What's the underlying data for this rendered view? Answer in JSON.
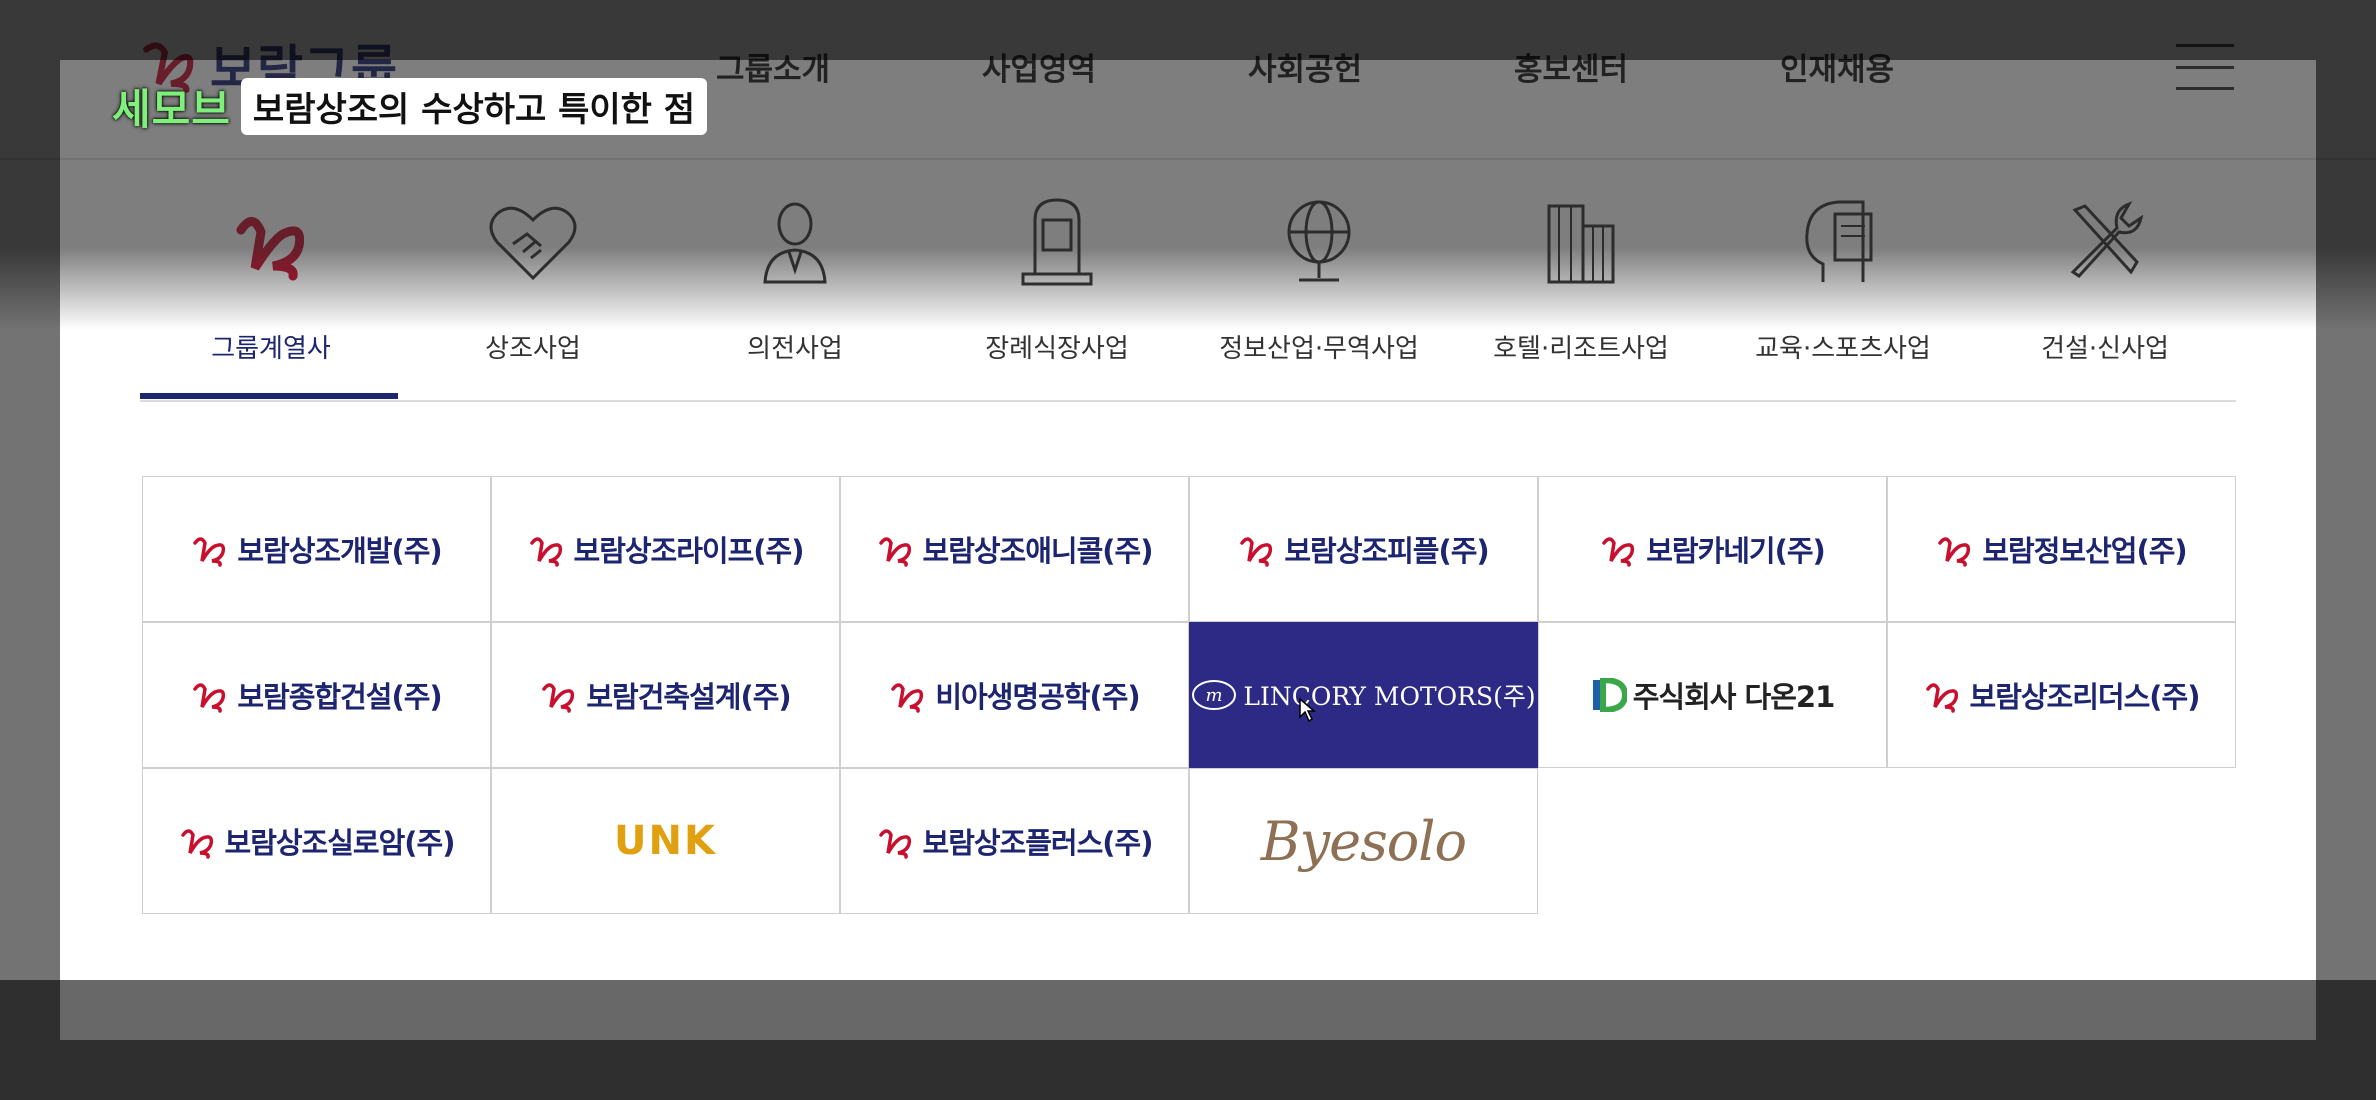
{
  "header": {
    "logo_text": "보람그룹",
    "nav": [
      "그룹소개",
      "사업영역",
      "사회공헌",
      "홍보센터",
      "인재채용"
    ]
  },
  "categories": [
    {
      "label": "그룹계열사",
      "icon": "boram-b-logo-icon",
      "active": true
    },
    {
      "label": "상조사업",
      "icon": "handshake-heart-icon"
    },
    {
      "label": "의전사업",
      "icon": "person-suit-icon"
    },
    {
      "label": "장례식장사업",
      "icon": "tombstone-icon"
    },
    {
      "label": "정보산업·무역사업",
      "icon": "globe-icon"
    },
    {
      "label": "호텔·리조트사업",
      "icon": "buildings-icon"
    },
    {
      "label": "교육·스포츠사업",
      "icon": "head-book-icon"
    },
    {
      "label": "건설·신사업",
      "icon": "tools-icon"
    }
  ],
  "companies": [
    {
      "name": "보람상조개발(주)",
      "logo": "boram"
    },
    {
      "name": "보람상조라이프(주)",
      "logo": "boram"
    },
    {
      "name": "보람상조애니콜(주)",
      "logo": "boram"
    },
    {
      "name": "보람상조피플(주)",
      "logo": "boram"
    },
    {
      "name": "보람카네기(주)",
      "logo": "boram"
    },
    {
      "name": "보람정보산업(주)",
      "logo": "boram"
    },
    {
      "name": "보람종합건설(주)",
      "logo": "boram"
    },
    {
      "name": "보람건축설계(주)",
      "logo": "boram"
    },
    {
      "name": "비아생명공학(주)",
      "logo": "boram"
    },
    {
      "name": "LINCORY MOTORS(주)",
      "logo": "lincory",
      "highlighted": true
    },
    {
      "name": "주식회사 다온21",
      "logo": "daon"
    },
    {
      "name": "보람상조리더스(주)",
      "logo": "boram"
    },
    {
      "name": "보람상조실로암(주)",
      "logo": "boram"
    },
    {
      "name": "UNK",
      "logo": "unk"
    },
    {
      "name": "보람상조플러스(주)",
      "logo": "boram"
    },
    {
      "name": "Byesolo",
      "logo": "byesolo"
    }
  ],
  "caption": {
    "brand": "세모브",
    "text": "보람상조의 수상하고 특이한 점"
  },
  "colors": {
    "navy": "#1d2470",
    "brand_red": "#c8102e",
    "highlight_bg": "#2d2a86",
    "caption_green": "#7ff07a"
  }
}
